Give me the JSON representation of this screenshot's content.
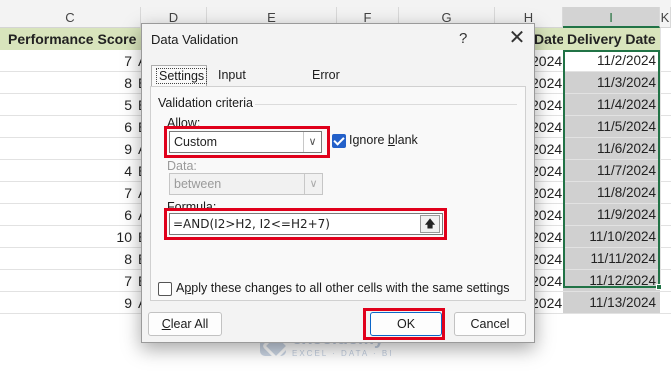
{
  "sheet": {
    "columns": [
      "C",
      "D",
      "E",
      "F",
      "G",
      "H",
      "I",
      "K"
    ],
    "selected_column": "I",
    "header_performance": "Performance Score",
    "header_partial_c": "C",
    "header_partial_h": "Date",
    "header_delivery": "Delivery Date",
    "scores": [
      "7",
      "8",
      "5",
      "6",
      "9",
      "4",
      "7",
      "6",
      "10",
      "8",
      "7",
      "9"
    ],
    "partial_letters": [
      "A",
      "E",
      "E",
      "E",
      "A",
      "E",
      "A",
      "A",
      "E",
      "E",
      "E",
      "A"
    ],
    "h_values": [
      "2024",
      "2024",
      "2024",
      "2024",
      "2024",
      "2024",
      "2024",
      "2024",
      "2024",
      "2024",
      "2024",
      "2024"
    ],
    "delivery_dates": [
      "11/2/2024",
      "11/3/2024",
      "11/4/2024",
      "11/5/2024",
      "11/6/2024",
      "11/7/2024",
      "11/8/2024",
      "11/9/2024",
      "11/10/2024",
      "11/11/2024",
      "11/12/2024",
      "11/13/2024"
    ]
  },
  "dialog": {
    "title": "Data Validation",
    "help": "?",
    "close": "✕",
    "tabs": [
      "Settings",
      "Input Message",
      "Error Alert"
    ],
    "active_tab": "Settings",
    "group_label": "Validation criteria",
    "allow_label": "Allow:",
    "allow_value": "Custom",
    "ignore_blank_pre": "Ignore ",
    "ignore_blank_u": "b",
    "ignore_blank_post": "lank",
    "ignore_blank_checked": true,
    "data_label": "Data:",
    "data_value": "between",
    "formula_label": "Formula:",
    "formula_value": "=AND(I2>H2, I2<=H2+7)",
    "apply_pre": "A",
    "apply_u": "p",
    "apply_post": "ply these changes to all other cells with the same settings",
    "apply_checked": false,
    "clear_all_u": "C",
    "clear_all_post": "lear All",
    "ok_label": "OK",
    "cancel_label": "Cancel",
    "icons": {
      "dropdown": "chevron-down-icon",
      "collapse": "collapse-dialog-icon",
      "close": "close-icon"
    },
    "highlight_color": "#e0001b"
  },
  "watermark": {
    "name": "exceldemy",
    "tagline": "EXCEL · DATA · BI"
  }
}
